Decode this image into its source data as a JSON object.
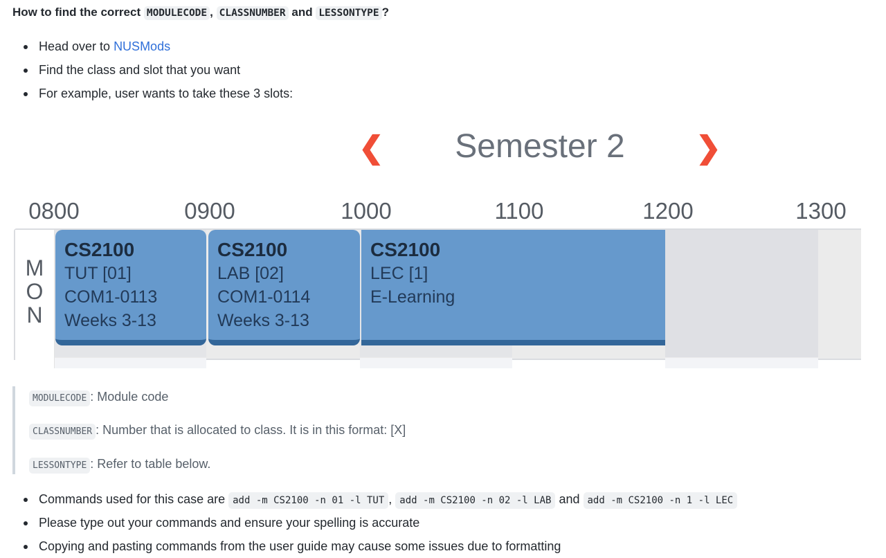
{
  "heading": {
    "prefix": "How to find the correct ",
    "code1": "MODULECODE",
    "sep1": ", ",
    "code2": "CLASSNUMBER",
    "sep2": " and ",
    "code3": "LESSONTYPE",
    "suffix": "?"
  },
  "steps": [
    {
      "text": "Head over to ",
      "link": "NUSMods"
    },
    {
      "text": "Find the class and slot that you want"
    },
    {
      "text": "For example, user wants to take these 3 slots:"
    }
  ],
  "timetable": {
    "semester": "Semester 2",
    "prev_icon": "chevron-left-icon",
    "next_icon": "chevron-right-icon",
    "accent": "#f04e37",
    "lesson_color": "#6699cc",
    "hours": [
      "0800",
      "0900",
      "1000",
      "1100",
      "1200",
      "1300"
    ],
    "day": [
      "M",
      "O",
      "N"
    ],
    "lessons": [
      {
        "code": "CS2100",
        "type": "TUT [01]",
        "venue": "COM1-0113",
        "weeks": "Weeks 3-13"
      },
      {
        "code": "CS2100",
        "type": "LAB [02]",
        "venue": "COM1-0114",
        "weeks": "Weeks 3-13"
      },
      {
        "code": "CS2100",
        "type": "LEC [1]",
        "venue": "E-Learning"
      }
    ]
  },
  "definitions": [
    {
      "code": "MODULECODE",
      "desc": ": Module code"
    },
    {
      "code": "CLASSNUMBER",
      "desc": ": Number that is allocated to class. It is in this format: [X]"
    },
    {
      "code": "LESSONTYPE",
      "desc": ": Refer to table below."
    }
  ],
  "notes": {
    "commands_prefix": "Commands used for this case are ",
    "cmd1": "add -m CS2100 -n 01 -l TUT",
    "sep1": ", ",
    "cmd2": "add -m CS2100 -n 02 -l LAB",
    "sep2": " and ",
    "cmd3": "add -m CS2100 -n 1 -l LEC",
    "note2": "Please type out your commands and ensure your spelling is accurate",
    "note3": "Copying and pasting commands from the user guide may cause some issues due to formatting"
  }
}
